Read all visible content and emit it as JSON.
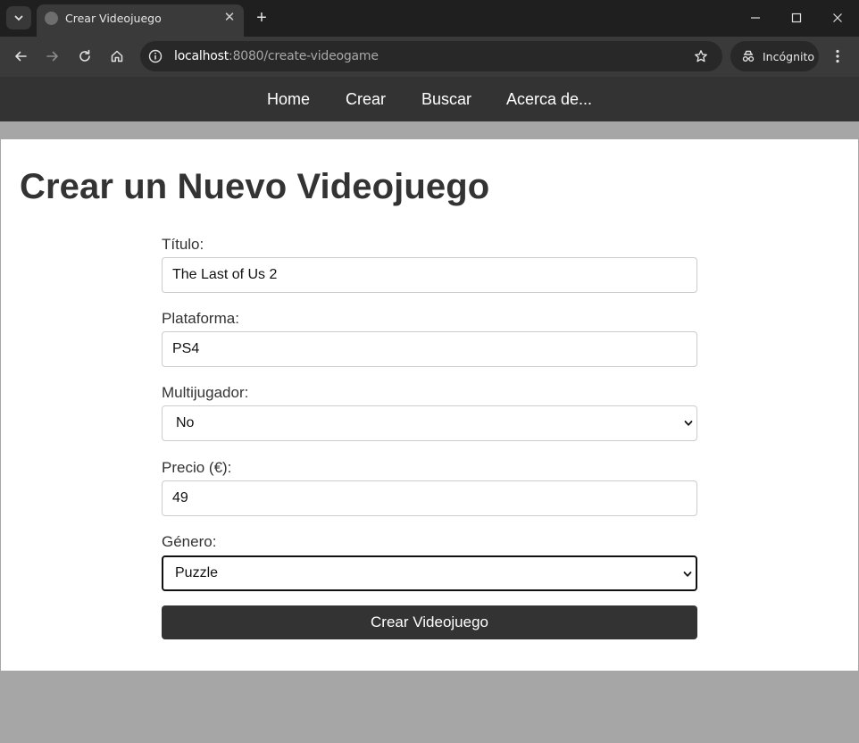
{
  "browser": {
    "tab_title": "Crear Videojuego",
    "tab_close_glyph": "✕",
    "new_tab_glyph": "+",
    "url_host": "localhost",
    "url_rest": ":8080/create-videogame",
    "incognito_label": "Incógnito",
    "icons": [
      "chevron-down-icon",
      "globe-icon",
      "close-icon",
      "plus-icon",
      "minimize-icon",
      "maximize-icon",
      "window-close-icon",
      "back-arrow-icon",
      "forward-arrow-icon",
      "reload-icon",
      "home-icon",
      "info-icon",
      "star-icon",
      "incognito-icon",
      "kebab-menu-icon"
    ]
  },
  "site_nav": {
    "items": [
      "Home",
      "Crear",
      "Buscar",
      "Acerca de..."
    ]
  },
  "page": {
    "heading": "Crear un Nuevo Videojuego"
  },
  "form": {
    "titulo": {
      "label": "Título:",
      "value": "The Last of Us 2"
    },
    "plataforma": {
      "label": "Plataforma:",
      "value": "PS4"
    },
    "multijugador": {
      "label": "Multijugador:",
      "selected": "No"
    },
    "precio": {
      "label": "Precio (€):",
      "value": "49"
    },
    "genero": {
      "label": "Género:",
      "selected": "Puzzle"
    },
    "submit_label": "Crear Videojuego"
  },
  "colors": {
    "nav_bg": "#333333",
    "button_bg": "#333333",
    "text": "#333333",
    "backdrop": "#a6a6a6"
  }
}
